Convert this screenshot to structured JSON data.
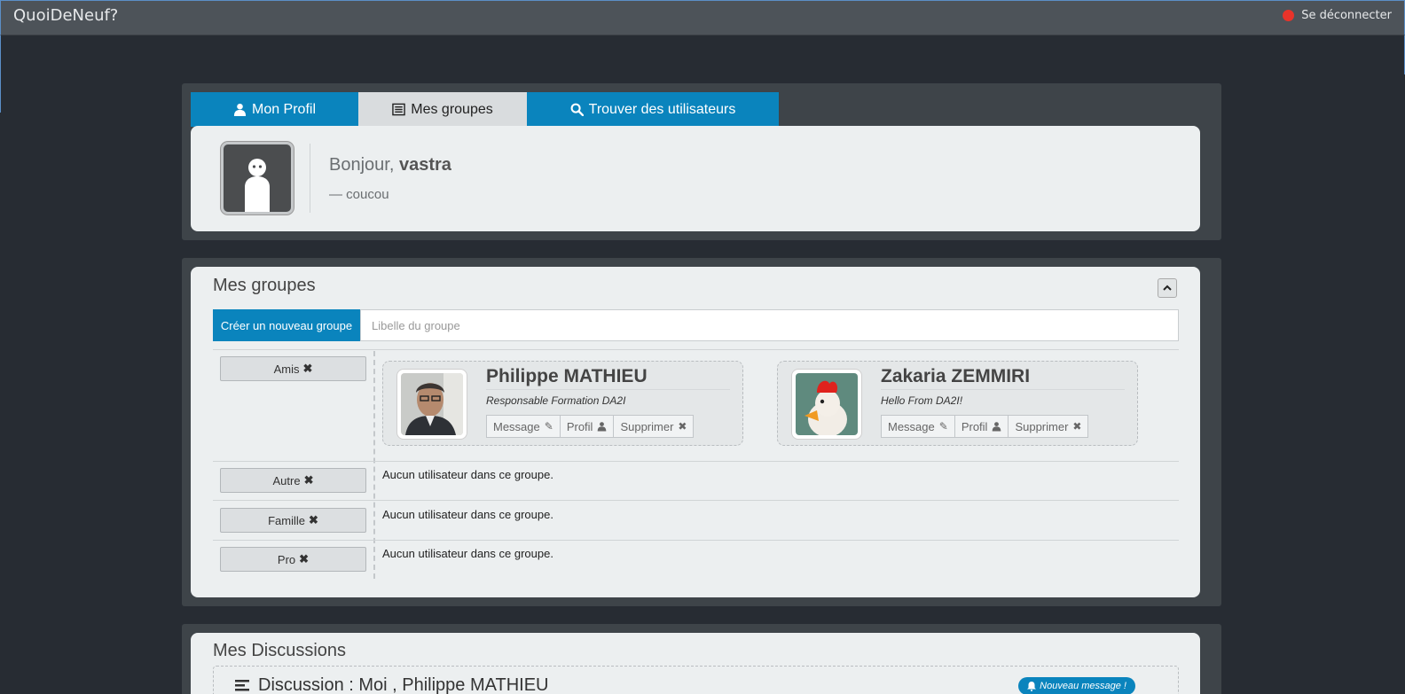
{
  "app": {
    "brand": "QuoiDeNeuf?",
    "logout_label": "Se déconnecter"
  },
  "tabs": [
    {
      "label": "Mon Profil",
      "icon": "user-icon"
    },
    {
      "label": "Mes groupes",
      "icon": "list-icon"
    },
    {
      "label": "Trouver des utilisateurs",
      "icon": "search-icon"
    }
  ],
  "profile": {
    "greeting": "Bonjour, ",
    "username": "vastra",
    "status": "— coucou"
  },
  "groups": {
    "title": "Mes groupes",
    "create_button": "Créer un nouveau groupe",
    "input_placeholder": "Libelle du groupe",
    "empty_message": "Aucun utilisateur dans ce groupe.",
    "list": [
      {
        "name": "Amis"
      },
      {
        "name": "Autre"
      },
      {
        "name": "Famille"
      },
      {
        "name": "Pro"
      }
    ],
    "members": [
      {
        "name": "Philippe MATHIEU",
        "status": "Responsable Formation DA2I"
      },
      {
        "name": "Zakaria ZEMMIRI",
        "status": "Hello From DA2I!"
      }
    ],
    "actions": {
      "message": "Message",
      "profile": "Profil",
      "delete": "Supprimer"
    }
  },
  "discussions": {
    "title": "Mes Discussions",
    "item_title": "Discussion : Moi , Philippe MATHIEU",
    "new_message": "Nouveau message !"
  },
  "colors": {
    "accent": "#0a84bd",
    "background": "#272c33",
    "logout_dot": "#e8332a"
  }
}
